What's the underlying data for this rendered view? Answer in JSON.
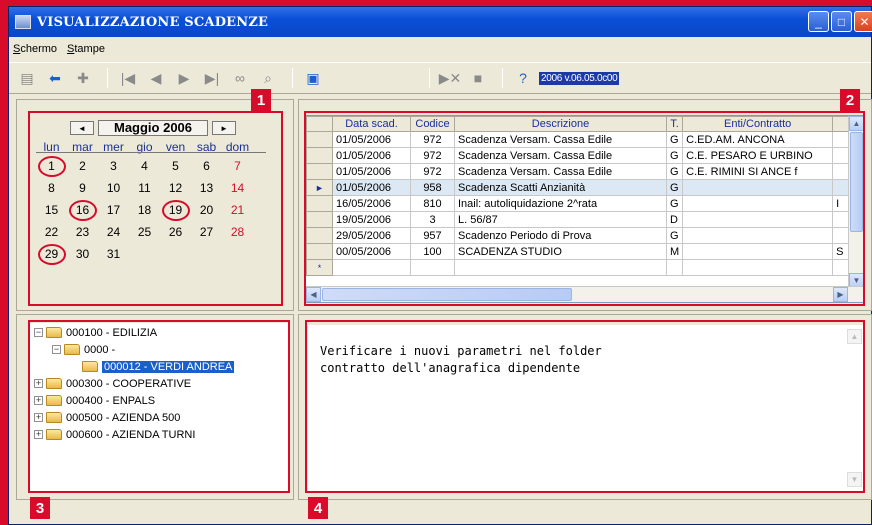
{
  "window": {
    "title": "VISUALIZZAZIONE SCADENZE",
    "buttons": {
      "minimize": "_",
      "maximize": "□",
      "close": "✕"
    }
  },
  "menu": [
    "Schermo",
    "Stampe"
  ],
  "toolbar": {
    "icons": [
      "save-icon",
      "back-icon",
      "puzzle-icon",
      "first-icon",
      "prev-icon",
      "next-icon",
      "last-icon",
      "binoculars-icon",
      "magnifier-icon",
      "calendar-icon",
      "delete-icon",
      "stop-icon",
      "help-icon"
    ],
    "version": "2006 v.06.05.0c00"
  },
  "badges": [
    "1",
    "2",
    "3",
    "4"
  ],
  "calendar": {
    "month": "Maggio 2006",
    "prev": "◄",
    "next": "►",
    "weekdays": [
      "lun",
      "mar",
      "mer",
      "gio",
      "ven",
      "sab",
      "dom"
    ],
    "weeks": [
      [
        "1",
        "2",
        "3",
        "4",
        "5",
        "6",
        "7"
      ],
      [
        "8",
        "9",
        "10",
        "11",
        "12",
        "13",
        "14"
      ],
      [
        "15",
        "16",
        "17",
        "18",
        "19",
        "20",
        "21"
      ],
      [
        "22",
        "23",
        "24",
        "25",
        "26",
        "27",
        "28"
      ],
      [
        "29",
        "30",
        "31",
        "",
        "",
        "",
        ""
      ]
    ],
    "circled_days": [
      "1",
      "16",
      "19",
      "29"
    ]
  },
  "grid": {
    "columns": [
      "Data scad.",
      "Codice",
      "Descrizione",
      "T.",
      "Enti/Contratto",
      ""
    ],
    "rows": [
      [
        "01/05/2006",
        "972",
        "Scadenza Versam. Cassa Edile",
        "G",
        "C.ED.AM. ANCONA",
        ""
      ],
      [
        "01/05/2006",
        "972",
        "Scadenza Versam. Cassa Edile",
        "G",
        "C.E. PESARO E URBINO",
        ""
      ],
      [
        "01/05/2006",
        "972",
        "Scadenza Versam. Cassa Edile",
        "G",
        "C.E. RIMINI SI ANCE f",
        ""
      ],
      [
        "01/05/2006",
        "958",
        "Scadenza Scatti Anzianità",
        "G",
        "",
        ""
      ],
      [
        "16/05/2006",
        "810",
        "Inail: autoliquidazione 2^rata",
        "G",
        "",
        "I"
      ],
      [
        "19/05/2006",
        "3",
        "L. 56/87",
        "D",
        "",
        ""
      ],
      [
        "29/05/2006",
        "957",
        "Scadenzo Periodo di Prova",
        "G",
        "",
        ""
      ],
      [
        "00/05/2006",
        "100",
        "SCADENZA STUDIO",
        "M",
        "",
        "S"
      ]
    ],
    "current_row_marker": "►",
    "new_row_marker": "*"
  },
  "tree": [
    {
      "label": "000100 - EDILIZIA",
      "box": "−"
    },
    {
      "label": "0000 -",
      "box": "−"
    },
    {
      "label": "000012 - VERDI ANDREA",
      "box": ""
    },
    {
      "label": "000300 - COOPERATIVE",
      "box": "+"
    },
    {
      "label": "000400 - ENPALS",
      "box": "+"
    },
    {
      "label": "000500 - AZIENDA 500",
      "box": "+"
    },
    {
      "label": "000600 - AZIENDA TURNI",
      "box": "+"
    }
  ],
  "memo": {
    "line1": "Verificare i nuovi parametri nel folder",
    "line2": "contratto dell'anagrafica dipendente"
  },
  "colors": {
    "frame": "#d80b2a",
    "title": "#0a4fd8",
    "highlight": "#1d5fc8"
  }
}
